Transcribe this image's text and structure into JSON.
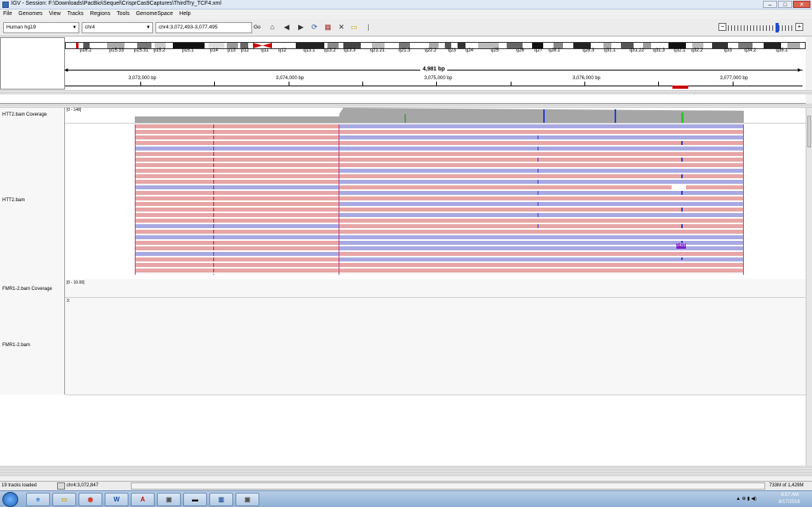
{
  "window": {
    "title": "IGV - Session: F:\\Downloads\\PacBio\\Sequel\\CrisprCas9Captures\\ThirdTry_TCF4.xml",
    "min_label": "–",
    "max_label": "□",
    "close_label": "✕"
  },
  "menu": [
    "File",
    "Genomes",
    "View",
    "Tracks",
    "Regions",
    "Tools",
    "GenomeSpace",
    "Help"
  ],
  "toolbar": {
    "genome": "Human hg19",
    "chromosome": "chr4",
    "locus": "chr4:3,072,493-3,077,495",
    "go_label": "Go"
  },
  "ideogram": {
    "bands": [
      "p16.2",
      "p15.33",
      "p15.31",
      "p15.2",
      "p15.1",
      "p14",
      "p13",
      "p12",
      "q11",
      "q12",
      "q13.1",
      "q13.2",
      "q13.3",
      "q21.21",
      "q21.3",
      "q22.2",
      "q23",
      "q24",
      "q25",
      "q26",
      "q27",
      "q28.1",
      "q28.3",
      "q31.1",
      "q31.22",
      "q31.3",
      "q32.1",
      "q32.2",
      "q33",
      "q34.2",
      "q35.1"
    ]
  },
  "ruler": {
    "span": "4,981 bp",
    "ticks": [
      "3,073,000 bp",
      "3,074,000 bp",
      "3,075,000 bp",
      "3,076,000 bp",
      "3,077,000 bp"
    ]
  },
  "tracks": {
    "htt2_coverage": {
      "name": "HTT2.bam Coverage",
      "range": "[0 - 148]"
    },
    "htt2_bam": {
      "name": "HTT2.bam",
      "insertion_label": "1423"
    },
    "fmr1_coverage": {
      "name": "FMR1-2.bam Coverage",
      "range": "[0 - 10.00]",
      "value": "3:"
    },
    "fmr1_bam": {
      "name": "FMR1-2.bam"
    }
  },
  "status": {
    "tracks_loaded": "19 tracks loaded",
    "position": "chr4:3,072,847",
    "memory": "733M of 1,429M"
  },
  "taskbar": {
    "time": "8:57 AM",
    "date": "8/17/2018"
  },
  "colors": {
    "read_forward": "#e7a5a5",
    "read_reverse": "#a8a8e2",
    "coverage": "#a6a6a6",
    "centromere": "#cc0000",
    "region_marker": "#cc0000",
    "insertion": "#7a1fc8"
  }
}
